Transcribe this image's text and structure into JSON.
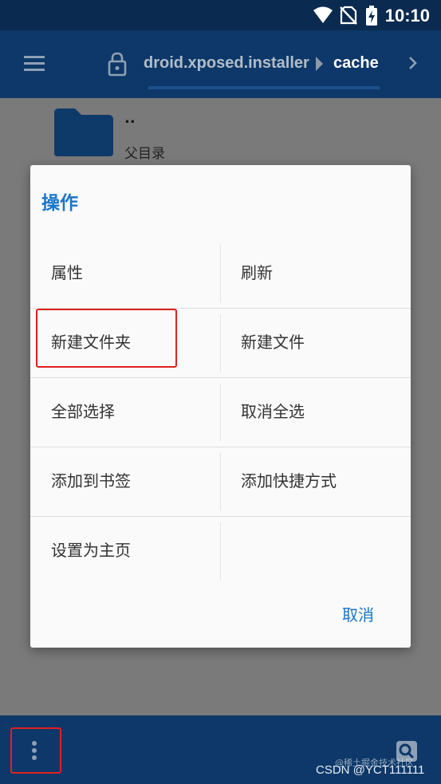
{
  "status_bar": {
    "time": "10:10",
    "icons": [
      "wifi-icon",
      "no-sim-icon",
      "battery-charging-icon"
    ]
  },
  "app_bar": {
    "menu_icon": "hamburger-menu-icon",
    "lock_icon": "lock-icon",
    "breadcrumb": {
      "parent": "droid.xposed.installer",
      "current": "cache"
    },
    "chevron_icon": "chevron-right-icon"
  },
  "file_list": {
    "items": [
      {
        "name": "..",
        "description": "父目录",
        "icon": "folder-icon"
      }
    ]
  },
  "dialog": {
    "title": "操作",
    "options": [
      {
        "label": "属性"
      },
      {
        "label": "刷新"
      },
      {
        "label": "新建文件夹"
      },
      {
        "label": "新建文件"
      },
      {
        "label": "全部选择"
      },
      {
        "label": "取消全选"
      },
      {
        "label": "添加到书签"
      },
      {
        "label": "添加快捷方式"
      },
      {
        "label": "设置为主页"
      },
      {
        "label": ""
      }
    ],
    "cancel_label": "取消"
  },
  "bottom_bar": {
    "more_icon": "more-vertical-icon",
    "search_icon": "search-icon"
  },
  "watermark": {
    "line1": "@稀土掘金技术社区",
    "line2": "CSDN @YCT111111"
  },
  "colors": {
    "app_bar": "#0d3869",
    "status_bar": "#0b2a4f",
    "accent": "#1976c9",
    "highlight": "#e02020",
    "scrim": "#7a7a7a"
  }
}
